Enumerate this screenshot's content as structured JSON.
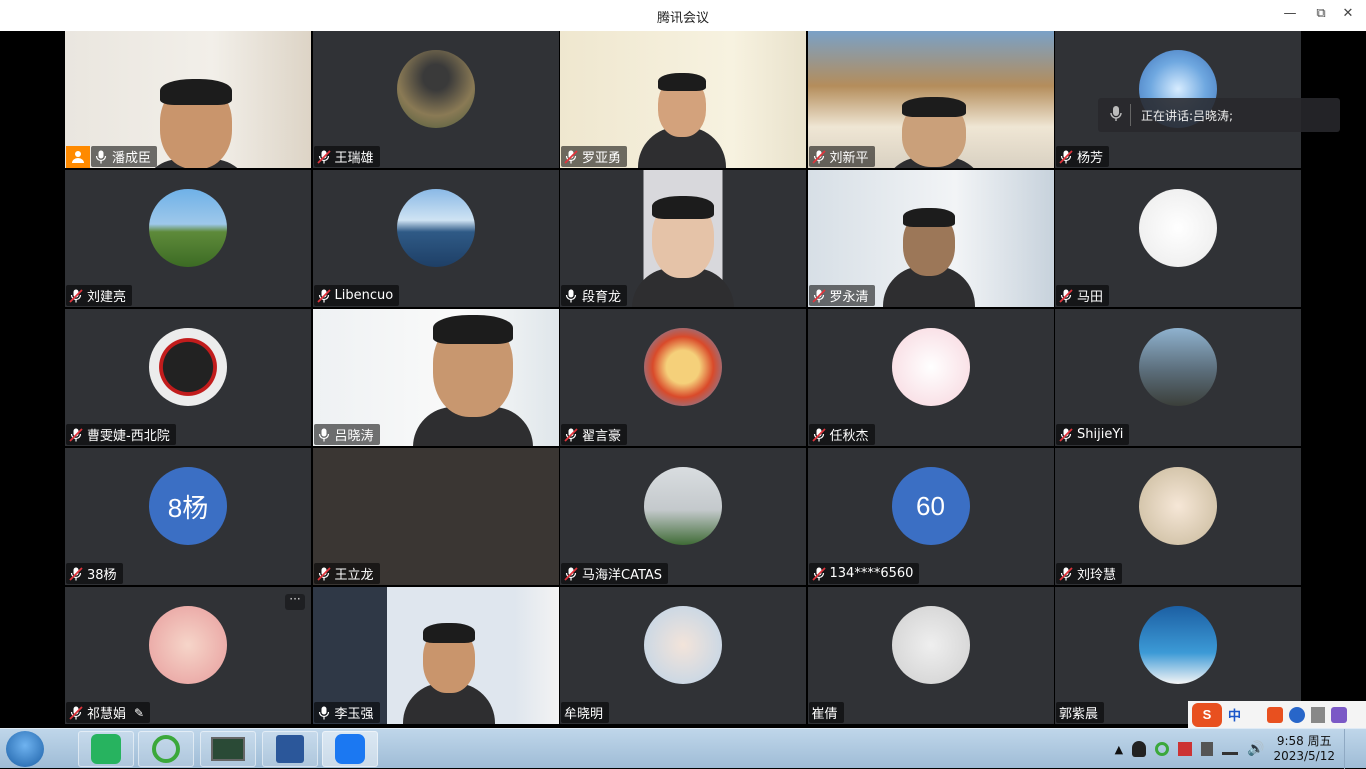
{
  "window": {
    "title": "腾讯会议"
  },
  "speaking": {
    "prefix": "正在讲话:",
    "name": "吕晓涛;"
  },
  "participants": [
    {
      "name": "潘成臣"
    },
    {
      "name": "王瑞雄"
    },
    {
      "name": "罗亚勇"
    },
    {
      "name": "刘新平"
    },
    {
      "name": "杨芳"
    },
    {
      "name": "刘建亮"
    },
    {
      "name": "Libencuo"
    },
    {
      "name": "段育龙"
    },
    {
      "name": "罗永清"
    },
    {
      "name": "马田"
    },
    {
      "name": "曹雯婕-西北院"
    },
    {
      "name": "吕晓涛"
    },
    {
      "name": "翟言豪"
    },
    {
      "name": "任秋杰"
    },
    {
      "name": "ShijieYi"
    },
    {
      "name": "38杨",
      "avatar_text": "8杨"
    },
    {
      "name": "王立龙"
    },
    {
      "name": "马海洋CATAS"
    },
    {
      "name": "134****6560",
      "avatar_text": "60"
    },
    {
      "name": "刘玲慧"
    },
    {
      "name": "祁慧娟"
    },
    {
      "name": "李玉强"
    },
    {
      "name": "牟晓明"
    },
    {
      "name": "崔倩"
    },
    {
      "name": "郭紫晨"
    }
  ],
  "more_button": "···",
  "ime": {
    "mode": "中"
  },
  "clock": {
    "time": "9:58 周五",
    "date": "2023/5/12"
  },
  "colors": {
    "tile_bg": "#303236",
    "active_outline": "#2dbb6c",
    "host_badge": "#ff8a00",
    "avatar_blue": "#3b6fc4"
  }
}
